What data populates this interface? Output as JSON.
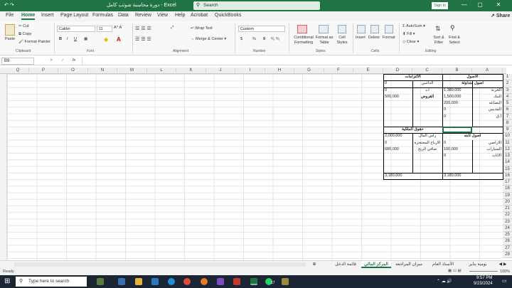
{
  "window": {
    "title": "دورة محاسبة شوتب كامل  -  Excel",
    "search_placeholder": "Search",
    "sign_in": "Sign in",
    "minimize": "—",
    "restore": "▢",
    "close": "✕"
  },
  "quick_access": {
    "autosave": "AutoSave",
    "undo": "↶",
    "redo": "↷"
  },
  "menu": [
    "File",
    "Home",
    "Insert",
    "Page Layout",
    "Formulas",
    "Data",
    "Review",
    "View",
    "Help",
    "Acrobat",
    "QuickBooks"
  ],
  "share": "Share",
  "ribbon": {
    "clipboard": {
      "paste": "Paste",
      "cut": "Cut",
      "copy": "Copy",
      "format_painter": "Format Painter",
      "label": "Clipboard"
    },
    "font": {
      "name": "Calibri",
      "size": "11",
      "label": "Font",
      "bold": "B",
      "italic": "I",
      "underline": "U"
    },
    "alignment": {
      "wrap": "Wrap Text",
      "merge": "Merge & Center",
      "label": "Alignment"
    },
    "number": {
      "format": "Custom",
      "label": "Number",
      "currency": "$",
      "percent": "%",
      "comma": "9"
    },
    "styles": {
      "conditional": "Conditional Formatting",
      "format_table": "Format as Table",
      "cell_styles": "Cell Styles",
      "label": "Styles"
    },
    "cells": {
      "insert": "Insert",
      "delete": "Delete",
      "format": "Format",
      "label": "Cells"
    },
    "editing": {
      "autosum": "AutoSum",
      "fill": "Fill",
      "clear": "Clear",
      "sort": "Sort & Filter",
      "find": "Find & Select",
      "label": "Editing"
    }
  },
  "formula_bar": {
    "name_box": "B9",
    "fx": "fx",
    "cancel": "✕",
    "enter": "✓",
    "value": ""
  },
  "columns": [
    "Q",
    "P",
    "O",
    "N",
    "M",
    "L",
    "K",
    "J",
    "I",
    "H",
    "G",
    "F",
    "E",
    "D",
    "C",
    "B",
    "A"
  ],
  "rows": [
    "1",
    "2",
    "3",
    "4",
    "5",
    "6",
    "7",
    "8",
    "9",
    "10",
    "11",
    "12",
    "13",
    "14",
    "15",
    "16",
    "17",
    "18",
    "19",
    "20",
    "21",
    "22",
    "23",
    "24",
    "25",
    "26",
    "27",
    "28"
  ],
  "cells": {
    "B1": "الاصول",
    "D1": "الالتزامات",
    "B2": "اصول متداولة",
    "C2": "الدائنين",
    "D2": "0",
    "A3": "الخزنة",
    "B3": "1,380,000",
    "C3": "أ.د",
    "D3": "0",
    "A4": "البنك",
    "B4": "1,500,000",
    "C4": "القروض",
    "D4": "500,000",
    "A5": "البضاعه",
    "B5": "200,000",
    "A6": "المدينين",
    "B6": "0",
    "A7": "أ.ق",
    "B7": "0",
    "C9": "حقوق الملكية",
    "B10": "اصول ثابته",
    "C10": "رأس المال",
    "D10": "2,000,000",
    "A11": "الاراضي",
    "B11": "0",
    "C11": "الارباح المحتجزة",
    "D11": "0",
    "A12": "السيارات",
    "B12": "100,000",
    "C12": "صافي الربح",
    "D12": "680,000",
    "A13": "الاثاث",
    "B13": "0",
    "B16": "3,180,000",
    "D16": "3,180,000"
  },
  "sheet_tabs": [
    "يومية يناير",
    "الأستاذ العام",
    "ميزان المراجعة",
    "المركز المالي",
    "قائمة الدخل"
  ],
  "active_sheet": "المركز المالي",
  "status": {
    "ready": "Ready",
    "zoom": "100%"
  },
  "taskbar": {
    "search": "Type here to search",
    "weather": "17",
    "time": "9:57 PM",
    "date": "9/23/2024"
  },
  "colors": {
    "excel_green": "#217346"
  }
}
